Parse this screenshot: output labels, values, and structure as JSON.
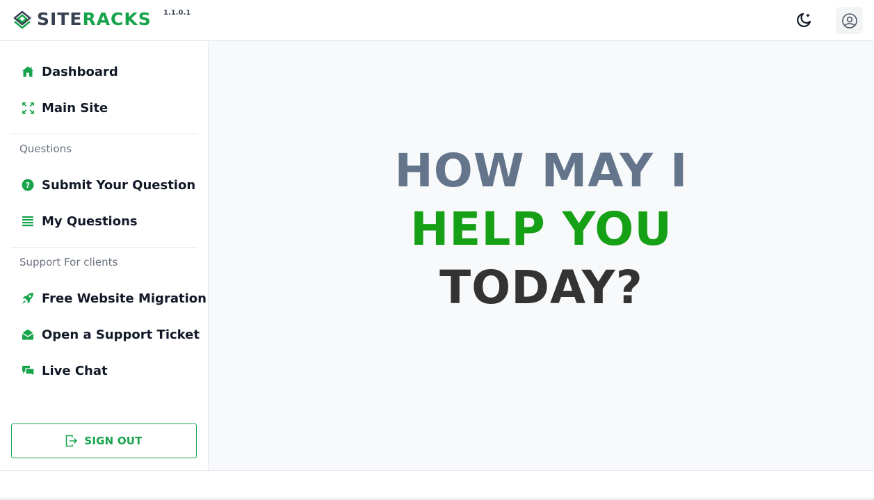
{
  "header": {
    "logo_part1": "SITE",
    "logo_part2": "RACKS",
    "version": "1.1.0.1",
    "theme_icon": "moon-stars-icon",
    "user_icon": "user-circle-icon"
  },
  "sidebar": {
    "nav": [
      {
        "label": "Dashboard",
        "icon": "home-icon"
      },
      {
        "label": "Main Site",
        "icon": "expand-icon"
      }
    ],
    "sections": [
      {
        "title": "Questions",
        "items": [
          {
            "label": "Submit Your Question",
            "icon": "question-circle-icon"
          },
          {
            "label": "My Questions",
            "icon": "list-icon"
          }
        ]
      },
      {
        "title": "Support For clients",
        "items": [
          {
            "label": "Free Website Migration",
            "icon": "rocket-icon"
          },
          {
            "label": "Open a Support Ticket",
            "icon": "envelope-open-icon"
          },
          {
            "label": "Live Chat",
            "icon": "chat-icon"
          }
        ]
      }
    ],
    "signout_label": "SIGN OUT",
    "signout_icon": "sign-out-icon"
  },
  "main": {
    "hero_line1": "HOW MAY I",
    "hero_line2": "HELP YOU",
    "hero_line3": "TODAY?"
  },
  "colors": {
    "accent": "#16a34a",
    "hero_gray": "#64748b",
    "hero_green": "#15a015",
    "hero_dark": "#333333"
  }
}
